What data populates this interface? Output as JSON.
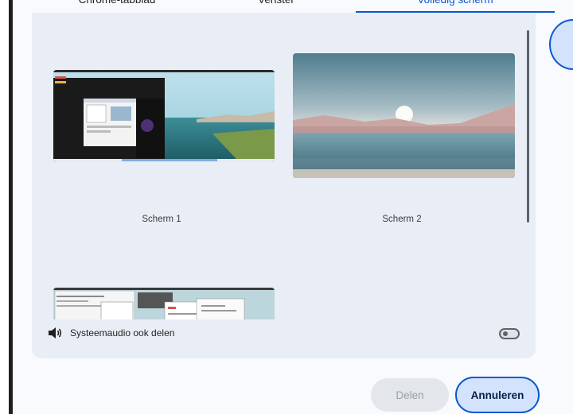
{
  "tabs": [
    {
      "label": "Chrome-tabblad",
      "active": false
    },
    {
      "label": "Venster",
      "active": false
    },
    {
      "label": "Volledig scherm",
      "active": true
    }
  ],
  "sources": [
    {
      "label": "Scherm 1"
    },
    {
      "label": "Scherm 2"
    },
    {
      "label": ""
    }
  ],
  "audio": {
    "label": "Systeemaudio ook delen",
    "enabled": false
  },
  "buttons": {
    "share": "Delen",
    "cancel": "Annuleren"
  },
  "colors": {
    "accent": "#0b57d0",
    "panel": "#e9eef6",
    "cancel_fill": "#d3e3fd"
  }
}
